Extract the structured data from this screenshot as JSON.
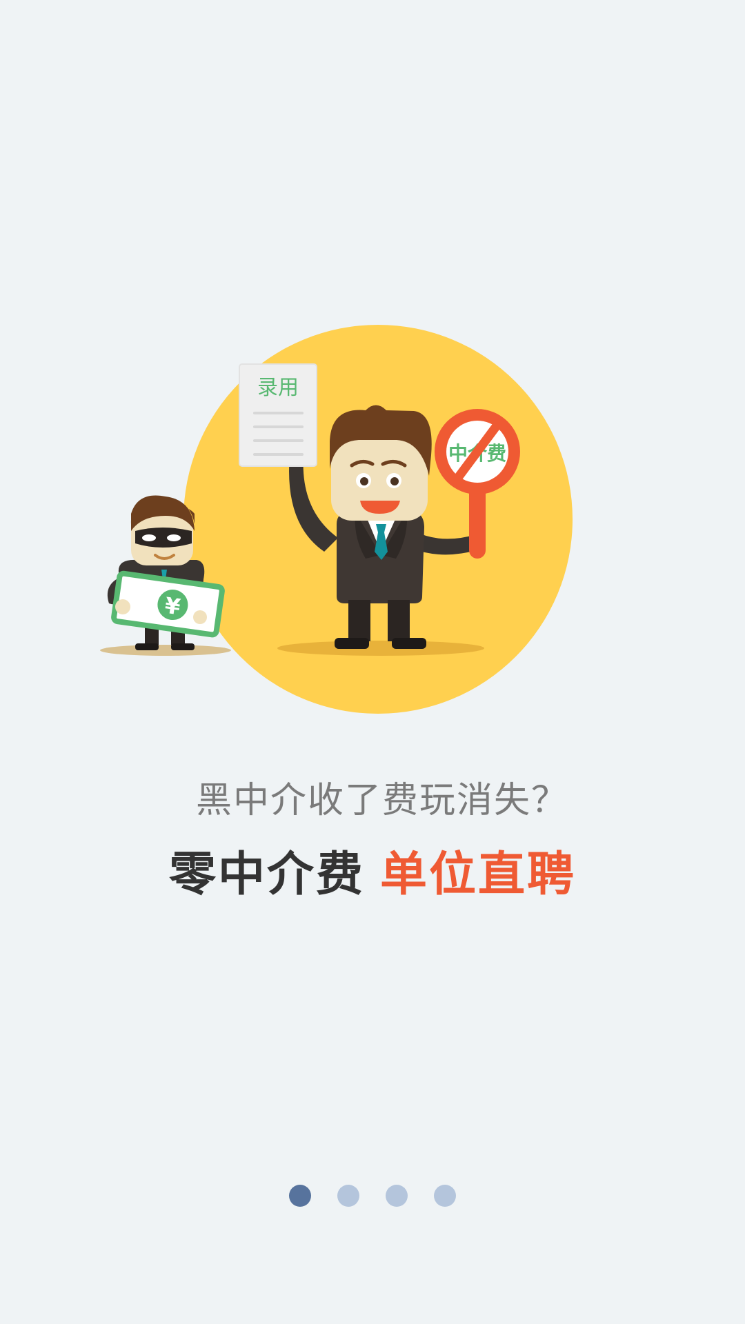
{
  "illustration": {
    "paper_label": "录用",
    "sign_label": "中介费",
    "money_symbol": "¥"
  },
  "headline": {
    "question": "黑中介收了费玩消失？",
    "slogan_dark": "零中介费",
    "slogan_accent": "单位直聘"
  },
  "pager": {
    "count": 4,
    "active_index": 0
  },
  "colors": {
    "background": "#eff3f5",
    "circle": "#ffd04f",
    "accent": "#ef5a33",
    "green": "#58b871",
    "dot_active": "#57739d",
    "dot_inactive": "#b4c5dc"
  }
}
